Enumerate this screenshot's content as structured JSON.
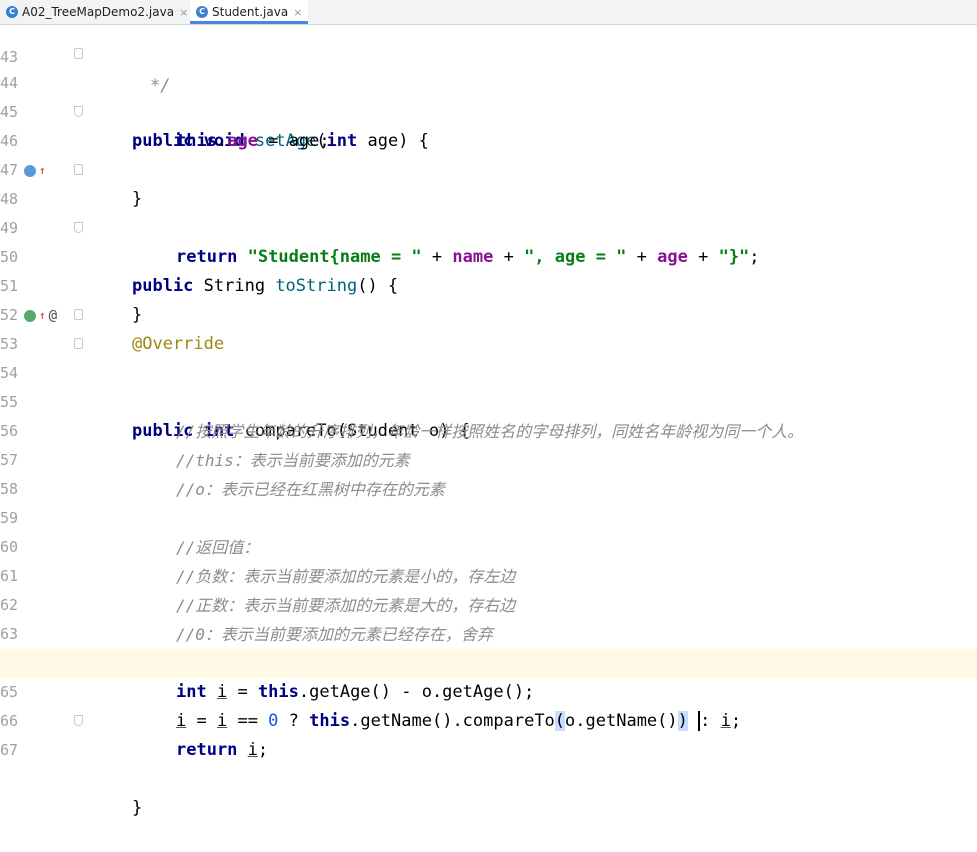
{
  "tabs": [
    {
      "label": "A02_TreeMapDemo2.java",
      "active": false
    },
    {
      "label": "Student.java",
      "active": true
    }
  ],
  "tab_icon_letter": "C",
  "close_glyph": "×",
  "editor": {
    "lines": [
      {
        "n": "43",
        "text": "*/"
      },
      {
        "n": "44",
        "text": "public void setAge(int age) {"
      },
      {
        "n": "45",
        "text": "this.age = age;"
      },
      {
        "n": "46",
        "text": "}"
      },
      {
        "n": "47",
        "text": ""
      },
      {
        "n": "48",
        "text": "public String toString() {"
      },
      {
        "n": "49",
        "text": "return \"Student{name = \" + name + \", age = \" + age + \"}\";"
      },
      {
        "n": "50",
        "text": "}"
      },
      {
        "n": "51",
        "text": ""
      },
      {
        "n": "52",
        "text": "@Override"
      },
      {
        "n": "53",
        "text": "public int compareTo(Student o) {"
      },
      {
        "n": "54",
        "text": "//按照学生年龄的升序排列，年龄一样按照姓名的字母排列，同姓名年龄视为同一个人。"
      },
      {
        "n": "55",
        "text": ""
      },
      {
        "n": "56",
        "text": "//this：表示当前要添加的元素"
      },
      {
        "n": "57",
        "text": "//o：表示已经在红黑树中存在的元素"
      },
      {
        "n": "58",
        "text": ""
      },
      {
        "n": "59",
        "text": "//返回值："
      },
      {
        "n": "60",
        "text": "//负数：表示当前要添加的元素是小的，存左边"
      },
      {
        "n": "61",
        "text": "//正数：表示当前要添加的元素是大的，存右边"
      },
      {
        "n": "62",
        "text": "//0：表示当前要添加的元素已经存在，舍弃"
      },
      {
        "n": "63",
        "text": ""
      },
      {
        "n": "64",
        "text": "int i = this.getAge() - o.getAge();"
      },
      {
        "n": "65",
        "text": "i = i == 0 ? this.getName().compareTo(o.getName()) : i;"
      },
      {
        "n": "66",
        "text": "return i;"
      },
      {
        "n": "67",
        "text": "}"
      }
    ],
    "tokens": {
      "l44": [
        "public",
        "void",
        "setAge",
        "(",
        "int",
        " age) {"
      ],
      "l45": [
        "this",
        ".",
        "age",
        " = age;"
      ],
      "l46": [
        "}"
      ],
      "l48": [
        "public",
        " String ",
        "toString",
        "() {"
      ],
      "l49": [
        "return",
        "\"Student{name = \"",
        " + ",
        "name",
        " + ",
        "\", age = \"",
        " + ",
        "age",
        " + ",
        "\"}\"",
        ";"
      ],
      "l50": [
        "}"
      ],
      "l52": [
        "@Override"
      ],
      "l53": [
        "public",
        "int",
        " compareTo(Student o) {"
      ],
      "l64": [
        "int",
        "i",
        " = ",
        "this",
        ".getAge() - o.getAge();"
      ],
      "l65": [
        "i",
        " = ",
        "i",
        " == ",
        "0",
        " ? ",
        "this",
        ".getName().compareTo",
        "(",
        "o.getName()",
        ")",
        "i",
        ";"
      ],
      "l66": [
        "return",
        "i",
        ";"
      ],
      "l67": [
        "}"
      ]
    }
  }
}
